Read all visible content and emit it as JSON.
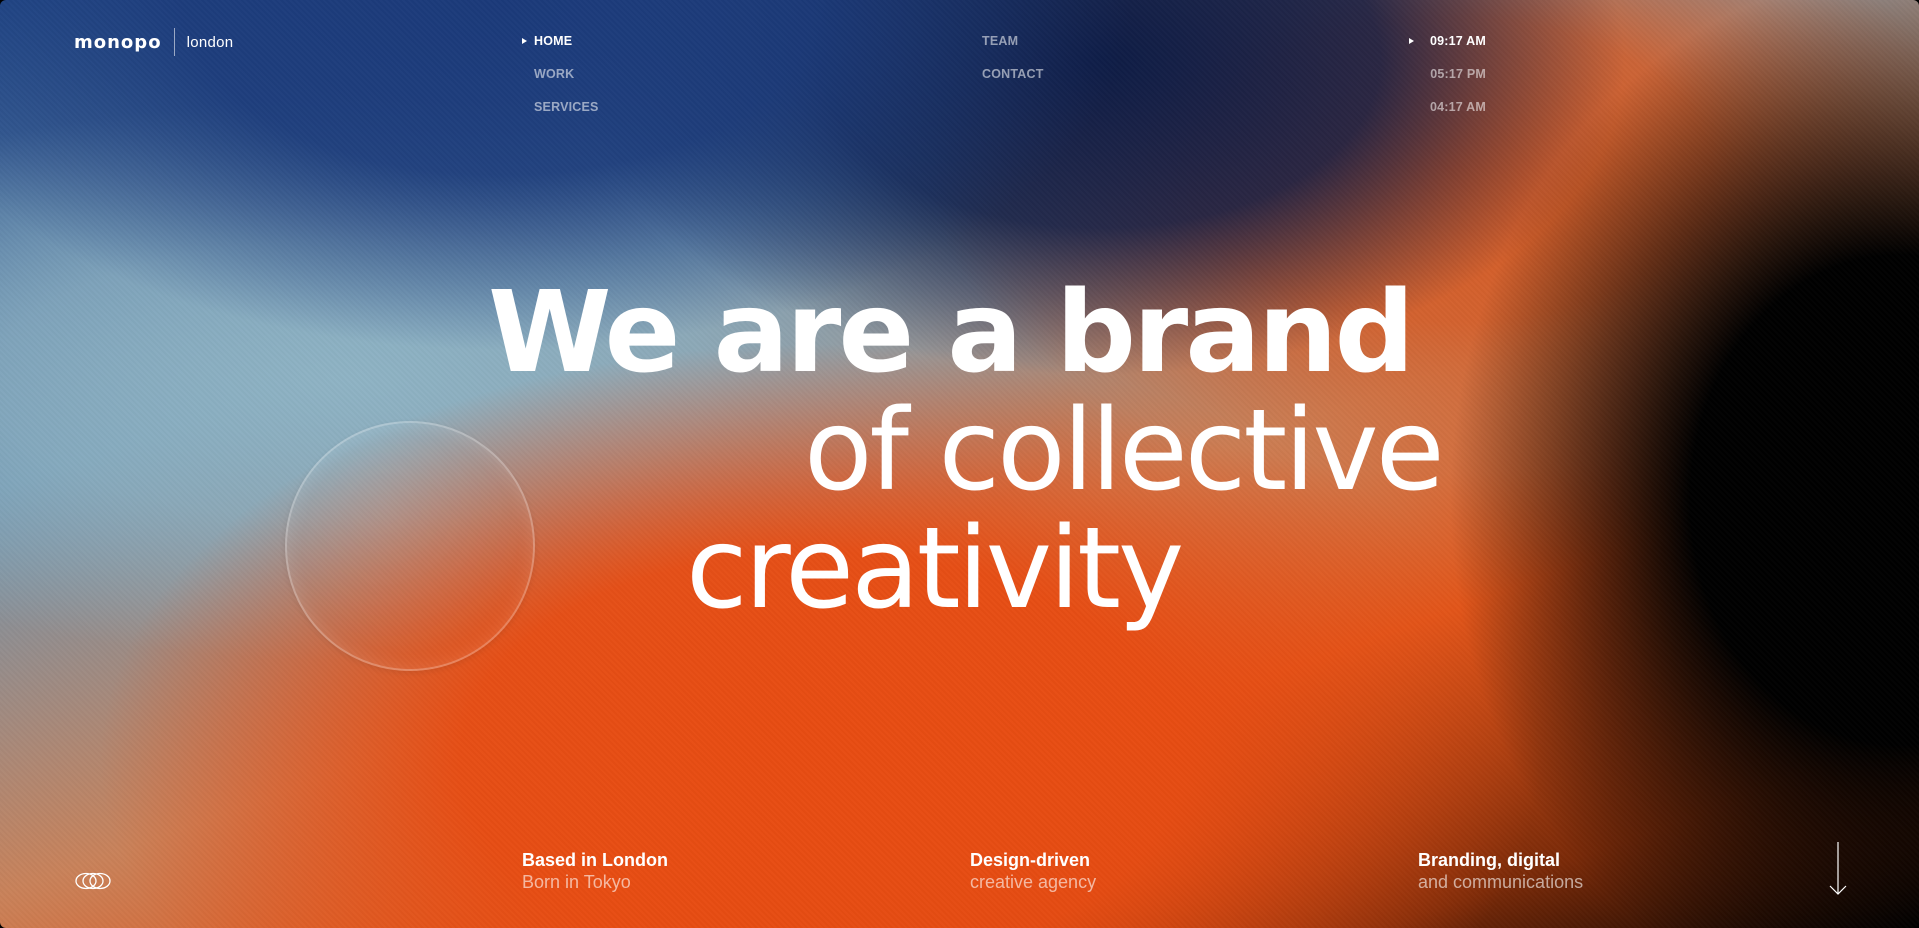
{
  "brand": {
    "name": "monopo",
    "city": "london"
  },
  "nav": {
    "items": [
      {
        "label": "HOME",
        "active": true
      },
      {
        "label": "WORK",
        "active": false
      },
      {
        "label": "SERVICES",
        "active": false
      },
      {
        "label": "TEAM",
        "active": false
      },
      {
        "label": "CONTACT",
        "active": false
      }
    ]
  },
  "clocks": {
    "times": [
      {
        "label": "09:17 AM",
        "active": true
      },
      {
        "label": "05:17 PM",
        "active": false
      },
      {
        "label": "04:17 AM",
        "active": false
      }
    ]
  },
  "hero": {
    "line1": "We are a brand",
    "line2": "of collective",
    "line3": "creativity"
  },
  "footer": {
    "blocks": [
      {
        "title": "Based in London",
        "subtitle": "Born in Tokyo"
      },
      {
        "title": "Design-driven",
        "subtitle": "creative agency"
      },
      {
        "title": "Branding, digital",
        "subtitle": "and communications"
      }
    ]
  },
  "icons": {
    "active_marker": "triangle-right-icon",
    "footer_logo": "monopo-rings-icon",
    "scroll": "arrow-down-icon"
  },
  "colors": {
    "text": "#ffffff",
    "muted_text": "rgba(255,255,255,0.55)",
    "navy": "#1b3a7a",
    "orange": "#e84c12",
    "black": "#000000"
  }
}
